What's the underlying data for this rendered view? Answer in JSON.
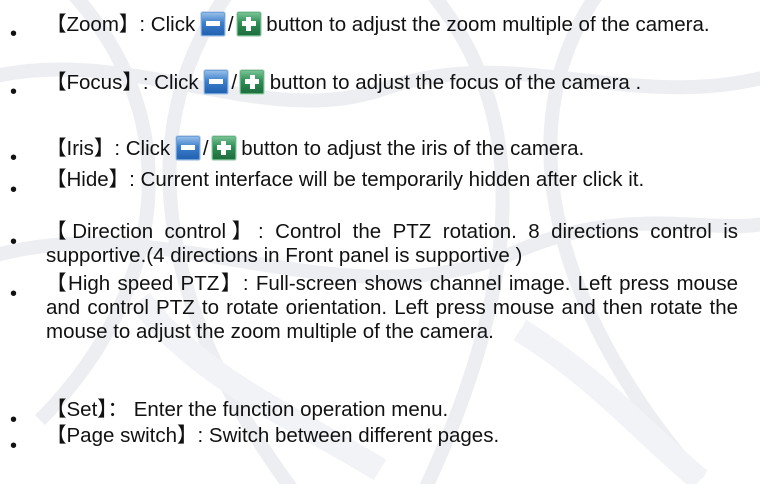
{
  "items": [
    {
      "bullet": "•",
      "before": "【Zoom】: Click ",
      "sep": "/",
      "after": " button to adjust the zoom multiple of the camera."
    },
    {
      "bullet": "•",
      "before": "【Focus】: Click ",
      "sep": "/",
      "after": " button to adjust the focus of the camera ."
    },
    {
      "bullet": "•",
      "before": "【Iris】: Click ",
      "sep": "/",
      "after": " button to adjust the iris of the camera."
    },
    {
      "bullet": "•",
      "text": "【Hide】: Current interface will be temporarily hidden after click it."
    },
    {
      "bullet": "•",
      "text": "【Direction control】: Control the PTZ rotation. 8 directions control is supportive.(4 directions in Front panel is supportive )"
    },
    {
      "bullet": "•",
      "text": "【High speed PTZ】: Full-screen shows channel image. Left press mouse and control PTZ to rotate orientation. Left press mouse and then rotate the mouse to adjust the zoom multiple of the camera."
    },
    {
      "bullet": "•",
      "text": "【Set】： Enter the function operation menu."
    },
    {
      "bullet": "•",
      "text": "【Page switch】: Switch between different pages."
    }
  ],
  "icons": {
    "minus": "minus-icon",
    "plus": "plus-icon"
  },
  "colors": {
    "text": "#111111",
    "minus_button": "#2f6fc0",
    "plus_button": "#2f8e55"
  }
}
